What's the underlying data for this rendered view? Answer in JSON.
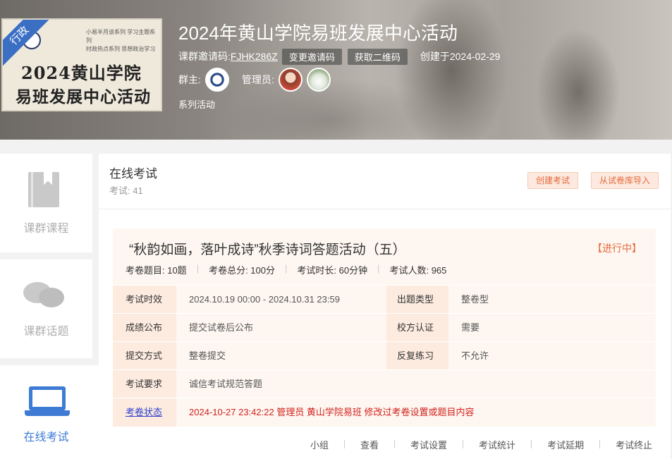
{
  "header": {
    "title": "2024年黄山学院易班发展中心活动",
    "invite_label": "课群邀请码:",
    "invite_code": "FJHK286Z",
    "change_code_label": "变更邀请码",
    "qrcode_label": "获取二维码",
    "created": "创建于2024-02-29",
    "owner_label": "群主:",
    "manager_label": "管理员:",
    "series_label": "系列活动",
    "cover": {
      "ribbon": "行政",
      "small_text": "小易半月谈系列 学习主题系列\n时政热点系列 思想政治学习",
      "line1": "2024黄山学院",
      "line2": "易班发展中心活动"
    }
  },
  "sidebar": {
    "items": [
      {
        "label": "课群课程",
        "icon": "book-icon",
        "active": false
      },
      {
        "label": "课群话题",
        "icon": "chat-icon",
        "active": false
      },
      {
        "label": "在线考试",
        "icon": "laptop-icon",
        "active": true
      }
    ]
  },
  "main": {
    "title": "在线考试",
    "count": "考试: 41",
    "create_button": "创建考试",
    "import_button": "从试卷库导入"
  },
  "exam": {
    "name": "“秋韵如画，落叶成诗”秋季诗词答题活动（五）",
    "status": "【进行中】",
    "stats": [
      "考卷题目: 10题",
      "考卷总分: 100分",
      "考试时长: 60分钟",
      "考试人数: 965"
    ],
    "rows": {
      "period_label": "考试时效",
      "period_value": "2024.10.19 00:00 - 2024.10.31 23:59",
      "type_label": "出题类型",
      "type_value": "整卷型",
      "score_label": "成绩公布",
      "score_value": "提交试卷后公布",
      "auth_label": "校方认证",
      "auth_value": "需要",
      "submit_label": "提交方式",
      "submit_value": "整卷提交",
      "practice_label": "反复练习",
      "practice_value": "不允许",
      "req_label": "考试要求",
      "req_value": "诚信考试规范答题",
      "state_label": "考卷状态",
      "state_value": "2024-10-27 23:42:22 管理员 黄山学院易班 修改过考卷设置或题目内容"
    },
    "actions": [
      "小组",
      "查看",
      "考试设置",
      "考试统计",
      "考试延期",
      "考试终止"
    ]
  },
  "colors": {
    "accent_blue": "#3d7bd4",
    "accent_orange": "#e46a3a",
    "status_red": "#d2211d",
    "link_blue": "#2c3fcf"
  }
}
